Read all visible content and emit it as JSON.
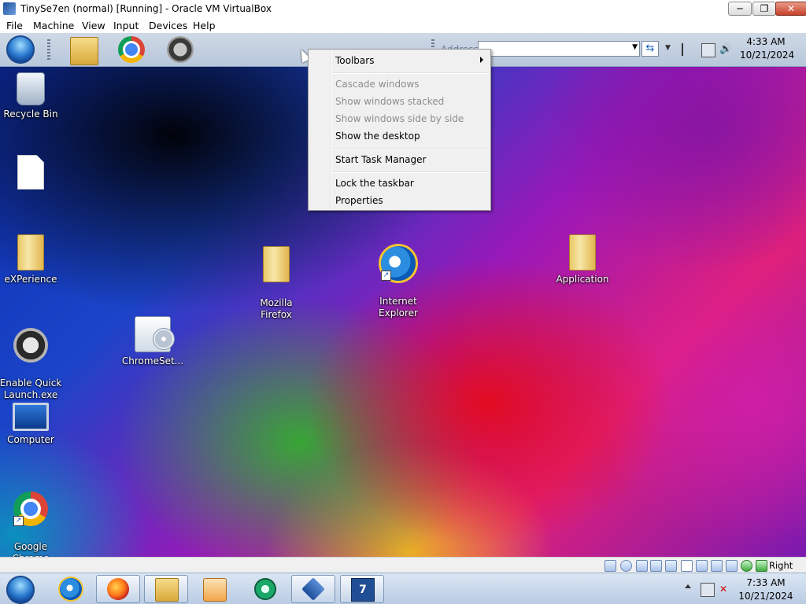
{
  "host_window": {
    "title": "TinySe7en (normal) [Running] - Oracle VM VirtualBox",
    "buttons": {
      "minimize": "─",
      "maximize": "❐",
      "close": "✕"
    }
  },
  "host_menu": [
    "File",
    "Machine",
    "View",
    "Input",
    "Devices",
    "Help"
  ],
  "guest_toolbar": {
    "address_label": "Address",
    "address_value": "",
    "clock_time": "4:33 AM",
    "clock_date": "10/21/2024"
  },
  "desktop_icons": [
    {
      "label": "Recycle Bin"
    },
    {
      "label": ""
    },
    {
      "label": "eXPerience"
    },
    {
      "label": "Mozilla\nFirefox"
    },
    {
      "label": "Internet\nExplorer"
    },
    {
      "label": "Application"
    },
    {
      "label": "Enable Quick\nLaunch.exe"
    },
    {
      "label": "ChromeSet..."
    },
    {
      "label": "Computer"
    },
    {
      "label": "Google\nChrome"
    }
  ],
  "context_menu": {
    "items": [
      {
        "label": "Toolbars",
        "enabled": true,
        "submenu": true
      },
      {
        "label": "Cascade windows",
        "enabled": false
      },
      {
        "label": "Show windows stacked",
        "enabled": false
      },
      {
        "label": "Show windows side by side",
        "enabled": false
      },
      {
        "label": "Show the desktop",
        "enabled": true
      },
      {
        "label": "Start Task Manager",
        "enabled": true
      },
      {
        "label": "Lock the taskbar",
        "enabled": true
      },
      {
        "label": "Properties",
        "enabled": true
      }
    ]
  },
  "vbox_status": {
    "host_key": "Right Ctrl"
  },
  "host_taskbar": {
    "clock_time": "7:33 AM",
    "clock_date": "10/21/2024",
    "pinned": [
      "internet-explorer",
      "firefox",
      "file-explorer",
      "media-player",
      "green-app",
      "virtualbox",
      "seven-app"
    ]
  }
}
